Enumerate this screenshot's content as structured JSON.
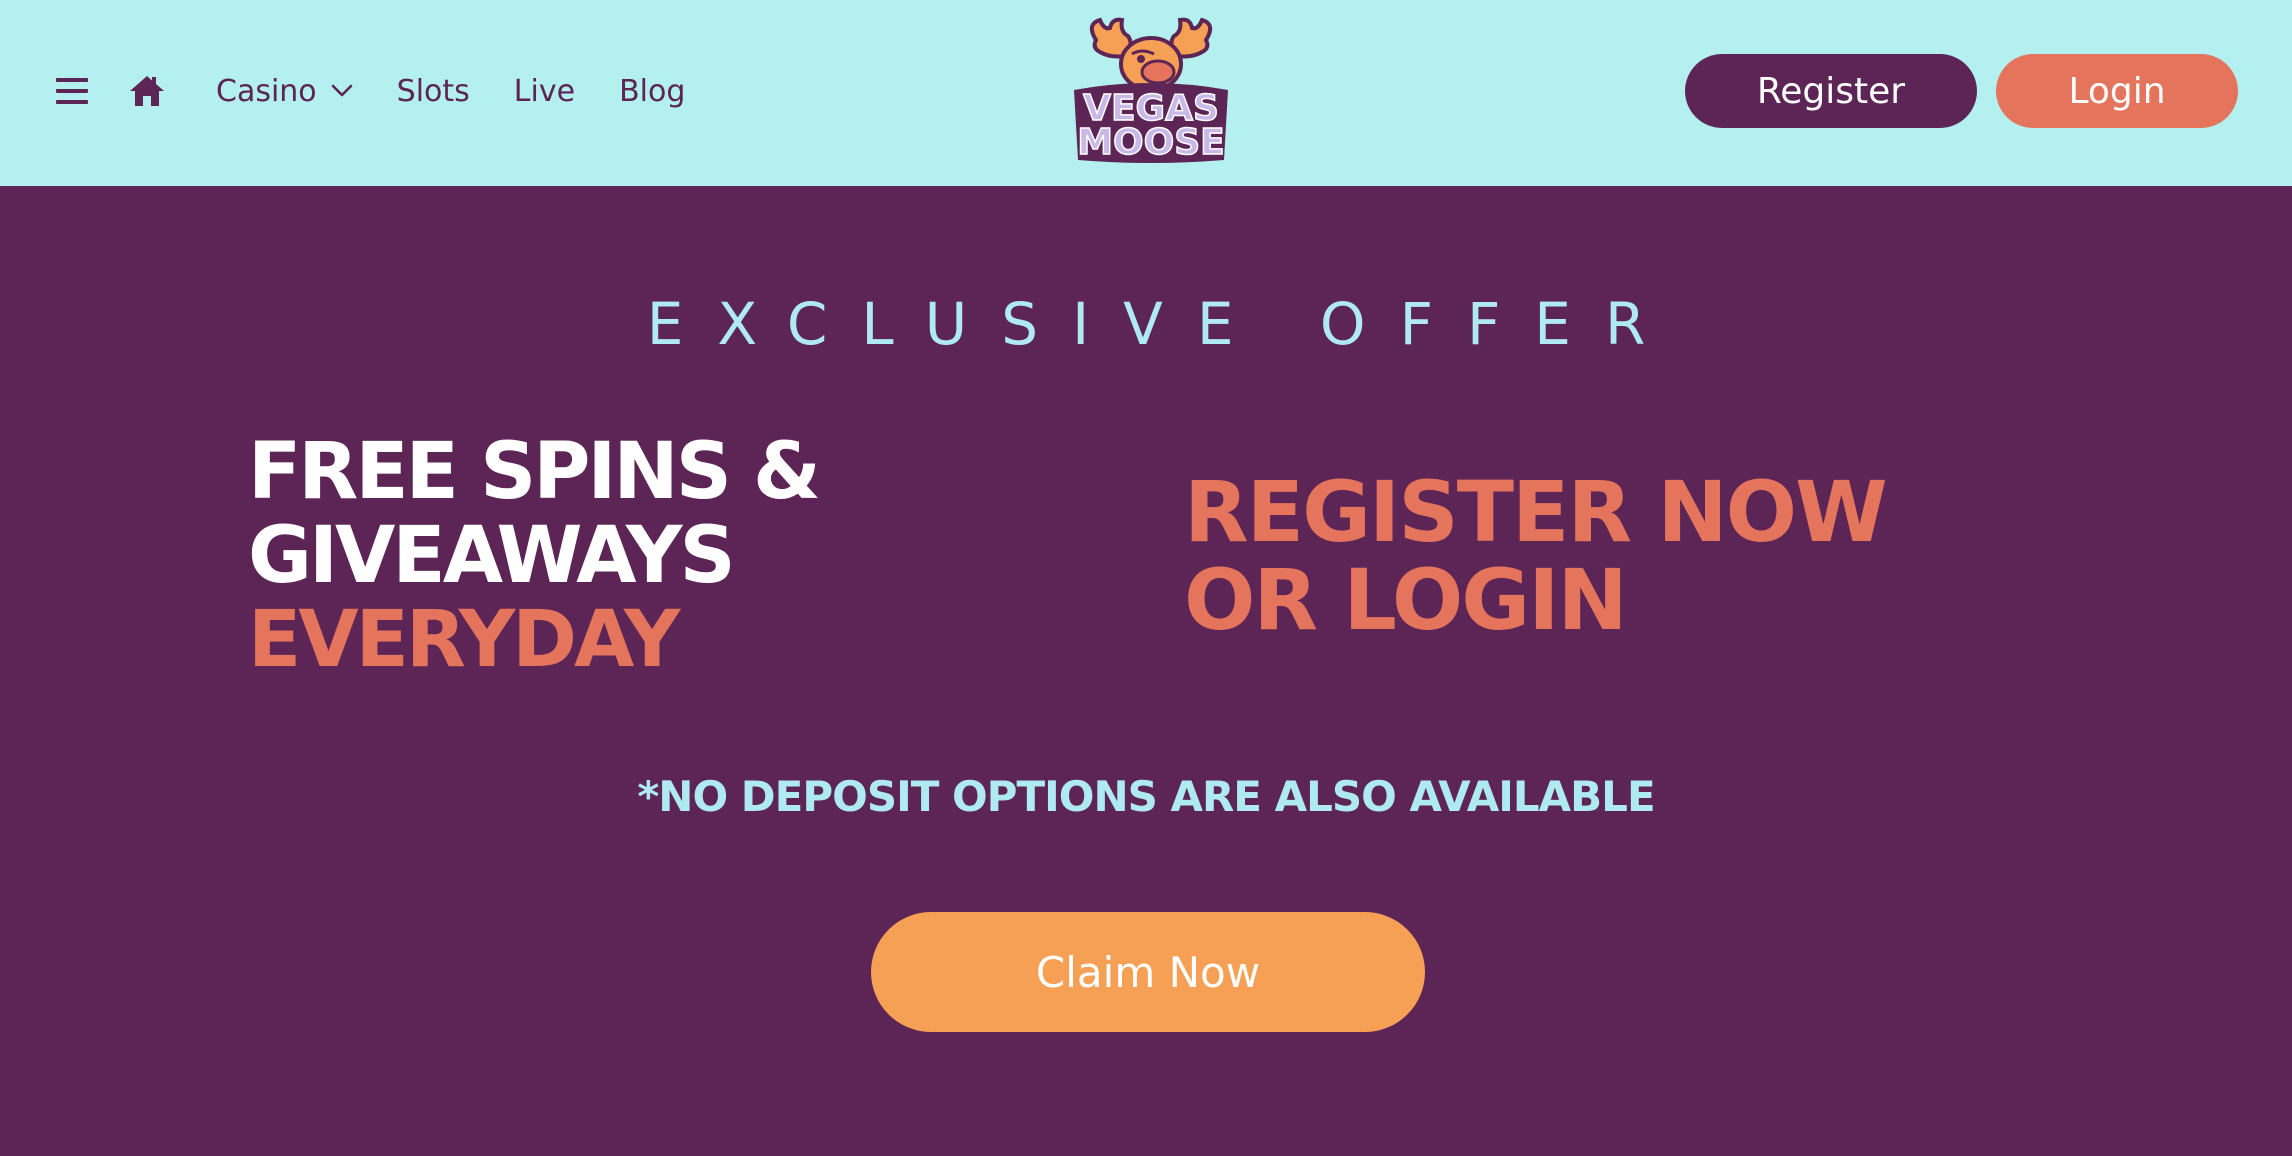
{
  "header": {
    "nav": {
      "casino_label": "Casino",
      "slots_label": "Slots",
      "live_label": "Live",
      "blog_label": "Blog"
    },
    "logo": {
      "line1": "VEGAS",
      "line2": "MOOSE"
    },
    "register_label": "Register",
    "login_label": "Login"
  },
  "hero": {
    "eyebrow": "EXCLUSIVE OFFER",
    "left_line1": "FREE SPINS &",
    "left_line2": "GIVEAWAYS",
    "left_line3": "EVERYDAY",
    "right_line1": "REGISTER NOW",
    "right_line2": "OR LOGIN",
    "note": "*NO DEPOSIT OPTIONS ARE ALSO AVAILABLE",
    "cta_label": "Claim Now"
  },
  "colors": {
    "header_bg": "#b4f0f0",
    "page_bg": "#5c2555",
    "accent_orange": "#e4745b",
    "cta_orange": "#f5a054",
    "light_cyan_text": "#aeeaf0"
  },
  "icons": {
    "menu": "hamburger-icon",
    "home": "home-icon",
    "dropdown": "chevron-down-icon"
  }
}
